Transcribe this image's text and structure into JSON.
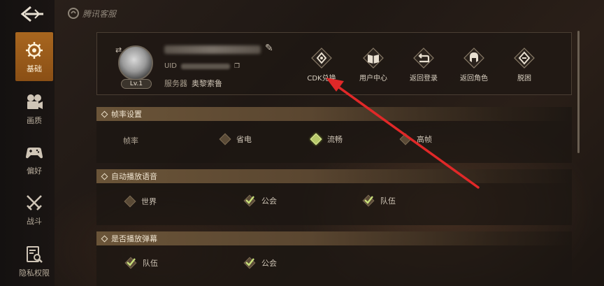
{
  "brand": {
    "name": "腾讯客服"
  },
  "sidebar": {
    "items": [
      {
        "label": "基础",
        "icon": "gear-icon"
      },
      {
        "label": "画质",
        "icon": "camera-icon"
      },
      {
        "label": "偏好",
        "icon": "gamepad-icon"
      },
      {
        "label": "战斗",
        "icon": "crossed-swords-icon"
      },
      {
        "label": "隐私权限",
        "icon": "privacy-search-icon"
      }
    ]
  },
  "profile": {
    "level": "Lv.1",
    "uid_label": "UID",
    "server_label": "服务器",
    "server_value": "奥黎索鲁"
  },
  "actions": [
    {
      "label": "CDK兑换",
      "icon": "diamond-emblem-icon"
    },
    {
      "label": "用户中心",
      "icon": "book-icon"
    },
    {
      "label": "返回登录",
      "icon": "return-icon"
    },
    {
      "label": "返回角色",
      "icon": "helmet-icon"
    },
    {
      "label": "脱困",
      "icon": "unstuck-icon"
    }
  ],
  "sections": {
    "framerate": {
      "title": "帧率设置",
      "row_label": "帧率",
      "options": [
        "省电",
        "流畅",
        "高帧"
      ],
      "selected": "流畅"
    },
    "voice": {
      "title": "自动播放语音",
      "options": [
        "世界",
        "公会",
        "队伍"
      ],
      "checked": [
        "公会",
        "队伍"
      ]
    },
    "danmaku": {
      "title": "是否播放弹幕",
      "options": [
        "队伍",
        "公会"
      ],
      "checked": [
        "队伍",
        "公会"
      ]
    }
  },
  "colors": {
    "accent": "#a8661f",
    "check": "#b7c96a",
    "annotation_arrow": "#e02828"
  }
}
